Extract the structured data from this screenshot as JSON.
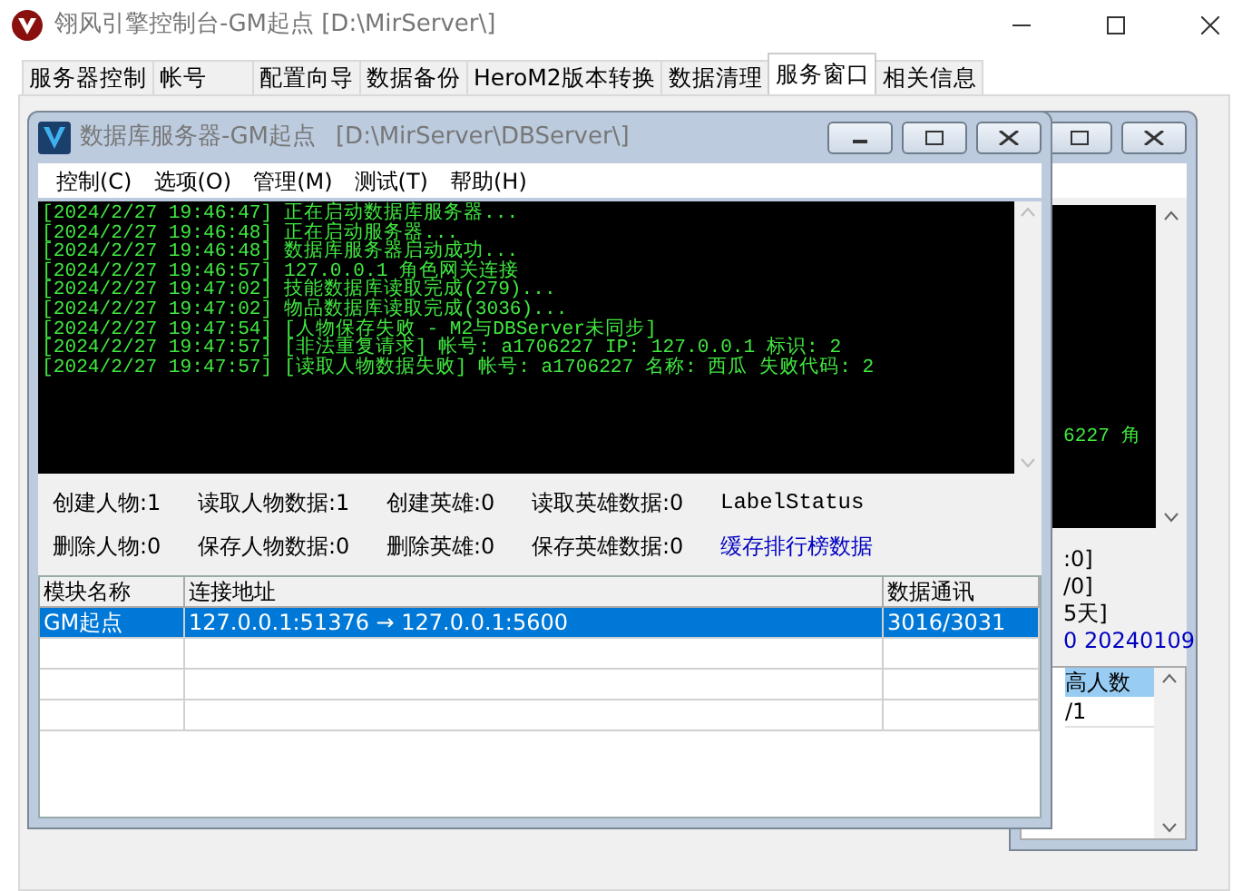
{
  "window": {
    "title": "翎风引擎控制台-GM起点 [D:\\MirServer\\]"
  },
  "tabs": [
    {
      "label": "服务器控制",
      "selected": false
    },
    {
      "label": "帐号",
      "selected": false
    },
    {
      "label": "配置向导",
      "selected": false
    },
    {
      "label": "数据备份",
      "selected": false
    },
    {
      "label": "HeroM2版本转换",
      "selected": false
    },
    {
      "label": "数据清理",
      "selected": false
    },
    {
      "label": "服务窗口",
      "selected": true
    },
    {
      "label": "相关信息",
      "selected": false
    }
  ],
  "back_window": {
    "log_fragment": "6227 角",
    "status_lines": [
      ":0]",
      "/0]",
      "5天]"
    ],
    "version": "0 20240109",
    "table": {
      "column": "高人数",
      "rows": [
        "/1"
      ]
    }
  },
  "db_window": {
    "title": "数据库服务器-GM起点",
    "path": "[D:\\MirServer\\DBServer\\]",
    "menu": [
      "控制(C)",
      "选项(O)",
      "管理(M)",
      "测试(T)",
      "帮助(H)"
    ],
    "log": [
      "[2024/2/27 19:46:47] 正在启动数据库服务器...",
      "[2024/2/27 19:46:48] 正在启动服务器...",
      "[2024/2/27 19:46:48] 数据库服务器启动成功...",
      "[2024/2/27 19:46:57] 127.0.0.1 角色网关连接",
      "[2024/2/27 19:47:02] 技能数据库读取完成(279)...",
      "[2024/2/27 19:47:02] 物品数据库读取完成(3036)...",
      "[2024/2/27 19:47:54] [人物保存失败 - M2与DBServer未同步]",
      "[2024/2/27 19:47:57] [非法重复请求] 帐号: a1706227 IP: 127.0.0.1 标识: 2",
      "[2024/2/27 19:47:57] [读取人物数据失败] 帐号: a1706227 名称: 西瓜 失败代码: 2"
    ],
    "stats": [
      [
        {
          "kind": "stat",
          "text": "创建人物:1"
        },
        {
          "kind": "stat",
          "text": "读取人物数据:1"
        },
        {
          "kind": "stat",
          "text": "创建英雄:0"
        },
        {
          "kind": "stat",
          "text": "读取英雄数据:0"
        },
        {
          "kind": "label",
          "text": "LabelStatus"
        }
      ],
      [
        {
          "kind": "stat",
          "text": "删除人物:0"
        },
        {
          "kind": "stat",
          "text": "保存人物数据:0"
        },
        {
          "kind": "stat",
          "text": "删除英雄:0"
        },
        {
          "kind": "stat",
          "text": "保存英雄数据:0"
        },
        {
          "kind": "link",
          "text": "缓存排行榜数据"
        }
      ]
    ],
    "table": {
      "columns": [
        "模块名称",
        "连接地址",
        "数据通讯"
      ],
      "rows": [
        {
          "cells": [
            "GM起点",
            "127.0.0.1:51376 → 127.0.0.1:5600",
            "3016/3031"
          ],
          "selected": true
        }
      ]
    }
  }
}
